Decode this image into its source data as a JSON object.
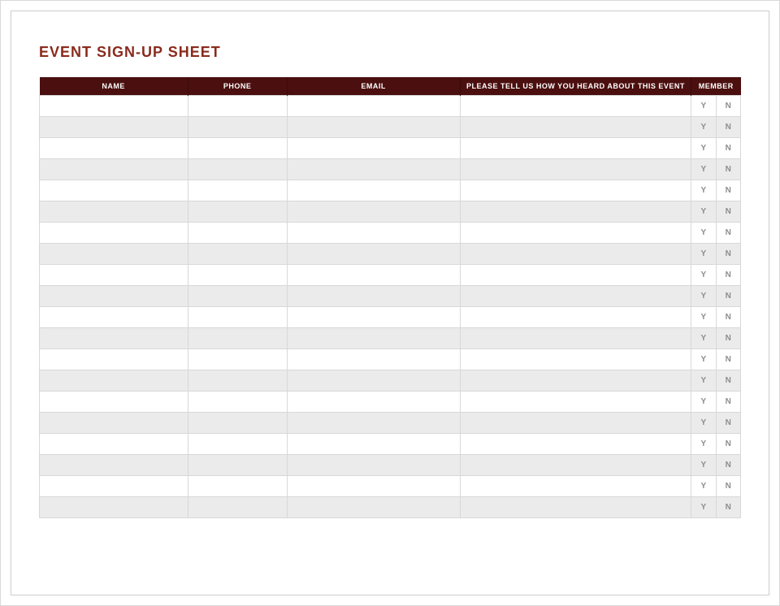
{
  "title": "EVENT SIGN-UP SHEET",
  "headers": {
    "name": "NAME",
    "phone": "PHONE",
    "email": "EMAIL",
    "heard": "PLEASE TELL US HOW YOU HEARD ABOUT THIS EVENT",
    "member": "MEMBER"
  },
  "member_labels": {
    "y": "Y",
    "n": "N"
  },
  "rows": [
    {
      "name": "",
      "phone": "",
      "email": "",
      "heard": "",
      "y": "Y",
      "n": "N"
    },
    {
      "name": "",
      "phone": "",
      "email": "",
      "heard": "",
      "y": "Y",
      "n": "N"
    },
    {
      "name": "",
      "phone": "",
      "email": "",
      "heard": "",
      "y": "Y",
      "n": "N"
    },
    {
      "name": "",
      "phone": "",
      "email": "",
      "heard": "",
      "y": "Y",
      "n": "N"
    },
    {
      "name": "",
      "phone": "",
      "email": "",
      "heard": "",
      "y": "Y",
      "n": "N"
    },
    {
      "name": "",
      "phone": "",
      "email": "",
      "heard": "",
      "y": "Y",
      "n": "N"
    },
    {
      "name": "",
      "phone": "",
      "email": "",
      "heard": "",
      "y": "Y",
      "n": "N"
    },
    {
      "name": "",
      "phone": "",
      "email": "",
      "heard": "",
      "y": "Y",
      "n": "N"
    },
    {
      "name": "",
      "phone": "",
      "email": "",
      "heard": "",
      "y": "Y",
      "n": "N"
    },
    {
      "name": "",
      "phone": "",
      "email": "",
      "heard": "",
      "y": "Y",
      "n": "N"
    },
    {
      "name": "",
      "phone": "",
      "email": "",
      "heard": "",
      "y": "Y",
      "n": "N"
    },
    {
      "name": "",
      "phone": "",
      "email": "",
      "heard": "",
      "y": "Y",
      "n": "N"
    },
    {
      "name": "",
      "phone": "",
      "email": "",
      "heard": "",
      "y": "Y",
      "n": "N"
    },
    {
      "name": "",
      "phone": "",
      "email": "",
      "heard": "",
      "y": "Y",
      "n": "N"
    },
    {
      "name": "",
      "phone": "",
      "email": "",
      "heard": "",
      "y": "Y",
      "n": "N"
    },
    {
      "name": "",
      "phone": "",
      "email": "",
      "heard": "",
      "y": "Y",
      "n": "N"
    },
    {
      "name": "",
      "phone": "",
      "email": "",
      "heard": "",
      "y": "Y",
      "n": "N"
    },
    {
      "name": "",
      "phone": "",
      "email": "",
      "heard": "",
      "y": "Y",
      "n": "N"
    },
    {
      "name": "",
      "phone": "",
      "email": "",
      "heard": "",
      "y": "Y",
      "n": "N"
    },
    {
      "name": "",
      "phone": "",
      "email": "",
      "heard": "",
      "y": "Y",
      "n": "N"
    }
  ]
}
